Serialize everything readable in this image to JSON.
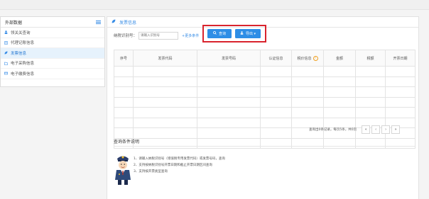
{
  "sidebar": {
    "title": "外部数据",
    "menu_icon": "menu-icon",
    "items": [
      {
        "label": "领关关查询",
        "icon": "person-icon"
      },
      {
        "label": "代理记账信息",
        "icon": "document-icon"
      },
      {
        "label": "发票信息",
        "icon": "leaf-icon",
        "active": true
      },
      {
        "label": "电子采购信息",
        "icon": "folder-icon"
      },
      {
        "label": "电子缴费信息",
        "icon": "card-icon"
      }
    ]
  },
  "main": {
    "header_title": "发票信息",
    "search": {
      "label": "纳税识别号：",
      "placeholder": "请输入识别号",
      "more_link": "+更多条件"
    },
    "buttons": {
      "query": "查询",
      "export": "导出 ▾"
    },
    "table": {
      "columns": [
        "序号",
        "发票代码",
        "发票号码",
        "认证信息",
        "税价信息",
        "金额",
        "税额",
        "开票日期"
      ],
      "empty_rows": 8
    },
    "pager": {
      "info": "查询出0条记录，每页5条，共0页",
      "buttons": [
        "«",
        "‹",
        "›",
        "»"
      ]
    },
    "explain": {
      "title": "查询条件说明",
      "lines": [
        "1、请输入纳税识别号（增值税专用发票代码）或发票号码，查询",
        "2、支持按纳税识别号开票日期和截止开票日期区间查询",
        "3、支持按开票类型查询"
      ]
    }
  },
  "colors": {
    "accent": "#2e8ee6",
    "highlight": "#d9232d"
  }
}
